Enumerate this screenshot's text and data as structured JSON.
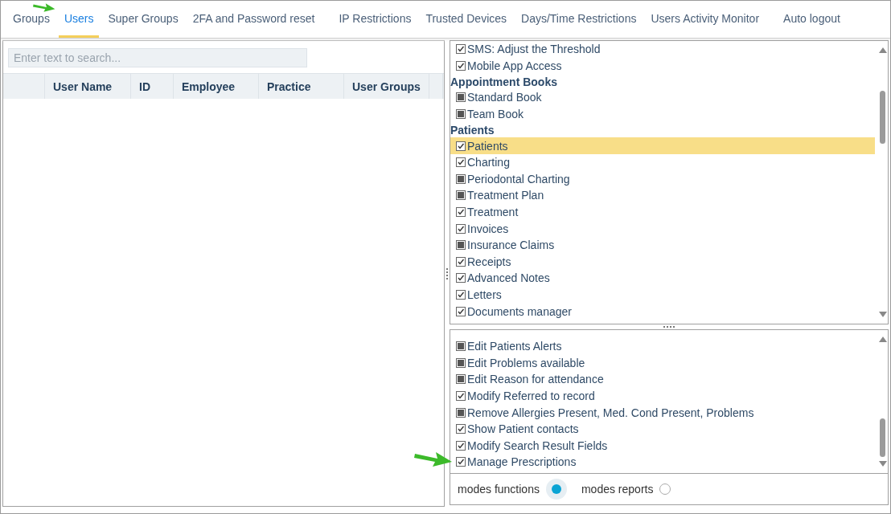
{
  "tabs": [
    {
      "label": "Groups",
      "selected": false
    },
    {
      "label": "Users",
      "selected": true
    },
    {
      "label": "Super Groups",
      "selected": false
    },
    {
      "label": "2FA and Password reset",
      "selected": false
    },
    {
      "label": "IP Restrictions",
      "selected": false
    },
    {
      "label": "Trusted Devices",
      "selected": false
    },
    {
      "label": "Days/Time Restrictions",
      "selected": false
    },
    {
      "label": "Users Activity Monitor",
      "selected": false
    },
    {
      "label": "Auto logout",
      "selected": false
    }
  ],
  "search": {
    "placeholder": "Enter text to search..."
  },
  "users_table": {
    "columns": [
      "",
      "User Name",
      "ID",
      "Employee",
      "Practice",
      "User Groups",
      ""
    ]
  },
  "permissions": [
    {
      "kind": "item",
      "label": "SMS: Adjust the Threshold",
      "checked": true,
      "selected": false
    },
    {
      "kind": "item",
      "label": "Mobile App Access",
      "checked": true,
      "selected": false
    },
    {
      "kind": "header",
      "label": "Appointment Books"
    },
    {
      "kind": "item",
      "label": "Standard Book",
      "checked": false,
      "selected": false
    },
    {
      "kind": "item",
      "label": "Team Book",
      "checked": false,
      "selected": false
    },
    {
      "kind": "header",
      "label": "Patients"
    },
    {
      "kind": "item",
      "label": "Patients",
      "checked": true,
      "selected": true
    },
    {
      "kind": "item",
      "label": "Charting",
      "checked": true,
      "selected": false
    },
    {
      "kind": "item",
      "label": "Periodontal Charting",
      "checked": false,
      "selected": false
    },
    {
      "kind": "item",
      "label": "Treatment Plan",
      "checked": false,
      "selected": false
    },
    {
      "kind": "item",
      "label": "Treatment",
      "checked": true,
      "selected": false
    },
    {
      "kind": "item",
      "label": "Invoices",
      "checked": true,
      "selected": false
    },
    {
      "kind": "item",
      "label": "Insurance Claims",
      "checked": false,
      "selected": false
    },
    {
      "kind": "item",
      "label": "Receipts",
      "checked": true,
      "selected": false
    },
    {
      "kind": "item",
      "label": "Advanced Notes",
      "checked": true,
      "selected": false
    },
    {
      "kind": "item",
      "label": "Letters",
      "checked": true,
      "selected": false
    },
    {
      "kind": "item",
      "label": "Documents manager",
      "checked": true,
      "selected": false
    }
  ],
  "functions": [
    {
      "label": "Edit Patients Alerts",
      "checked": false
    },
    {
      "label": "Edit Problems available",
      "checked": false
    },
    {
      "label": "Edit Reason for attendance",
      "checked": false
    },
    {
      "label": "Modify Referred to record",
      "checked": true
    },
    {
      "label": "Remove Allergies Present, Med. Cond Present, Problems",
      "checked": false
    },
    {
      "label": "Show Patient contacts",
      "checked": true
    },
    {
      "label": "Modify Search Result Fields",
      "checked": true
    },
    {
      "label": "Manage Prescriptions",
      "checked": true
    }
  ],
  "modes": [
    {
      "label": "modes functions",
      "selected": true
    },
    {
      "label": "modes reports",
      "selected": false
    }
  ]
}
